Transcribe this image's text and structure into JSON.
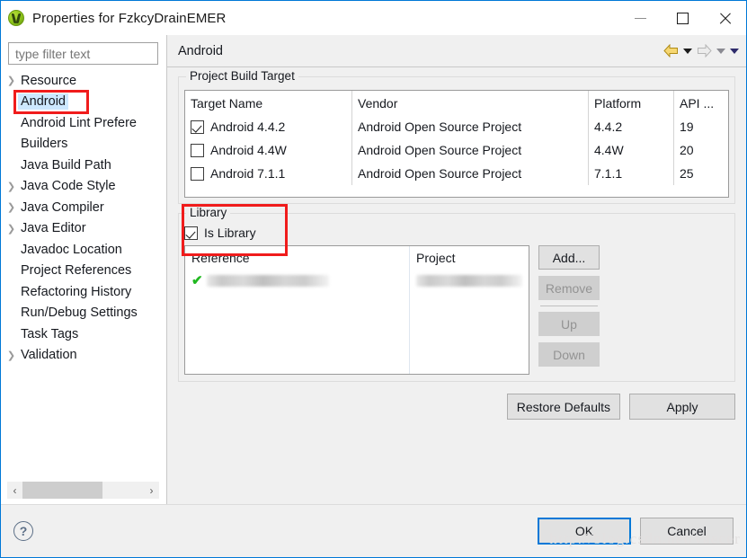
{
  "window": {
    "title": "Properties for FzkcyDrainEMER",
    "icon": "eclipse-app-icon",
    "controls": {
      "minimize": "—",
      "maximize": "□",
      "close": "✕"
    }
  },
  "sidebar": {
    "filter": {
      "placeholder": "type filter text",
      "value": ""
    },
    "items": [
      {
        "label": "Resource",
        "expandable": true,
        "selected": false
      },
      {
        "label": "Android",
        "expandable": false,
        "selected": true
      },
      {
        "label": "Android Lint Prefere",
        "expandable": false,
        "selected": false
      },
      {
        "label": "Builders",
        "expandable": false,
        "selected": false
      },
      {
        "label": "Java Build Path",
        "expandable": false,
        "selected": false
      },
      {
        "label": "Java Code Style",
        "expandable": true,
        "selected": false
      },
      {
        "label": "Java Compiler",
        "expandable": true,
        "selected": false
      },
      {
        "label": "Java Editor",
        "expandable": true,
        "selected": false
      },
      {
        "label": "Javadoc Location",
        "expandable": false,
        "selected": false
      },
      {
        "label": "Project References",
        "expandable": false,
        "selected": false
      },
      {
        "label": "Refactoring History",
        "expandable": false,
        "selected": false
      },
      {
        "label": "Run/Debug Settings",
        "expandable": false,
        "selected": false
      },
      {
        "label": "Task Tags",
        "expandable": false,
        "selected": false
      },
      {
        "label": "Validation",
        "expandable": true,
        "selected": false
      }
    ],
    "scrollbar": {
      "left_arrow": "‹",
      "right_arrow": "›"
    }
  },
  "page": {
    "title": "Android",
    "nav": {
      "back": "back-arrow",
      "back_menu": "dropdown",
      "forward": "forward-arrow",
      "forward_menu": "dropdown",
      "view_menu": "dropdown"
    }
  },
  "build_target": {
    "group_title": "Project Build Target",
    "columns": [
      "Target Name",
      "Vendor",
      "Platform",
      "API ..."
    ],
    "rows": [
      {
        "checked": true,
        "name": "Android 4.4.2",
        "vendor": "Android Open Source Project",
        "platform": "4.4.2",
        "api": "19"
      },
      {
        "checked": false,
        "name": "Android 4.4W",
        "vendor": "Android Open Source Project",
        "platform": "4.4W",
        "api": "20"
      },
      {
        "checked": false,
        "name": "Android 7.1.1",
        "vendor": "Android Open Source Project",
        "platform": "7.1.1",
        "api": "25"
      }
    ]
  },
  "library": {
    "group_title": "Library",
    "is_library_label": "Is Library",
    "is_library_checked": true,
    "highlight_color": "#f01c1c",
    "columns": [
      "Reference",
      "Project"
    ],
    "rows": [
      {
        "status": "✔",
        "reference": "",
        "project": ""
      }
    ],
    "buttons": [
      {
        "label": "Add...",
        "enabled": true
      },
      {
        "label": "Remove",
        "enabled": false
      },
      {
        "label": "Up",
        "enabled": false
      },
      {
        "label": "Down",
        "enabled": false
      }
    ]
  },
  "actions": {
    "restore_defaults": "Restore Defaults",
    "apply": "Apply"
  },
  "footer": {
    "help": "?",
    "ok": "OK",
    "cancel": "Cancel",
    "watermark": "http://blog.csdn.net/vaecer"
  }
}
